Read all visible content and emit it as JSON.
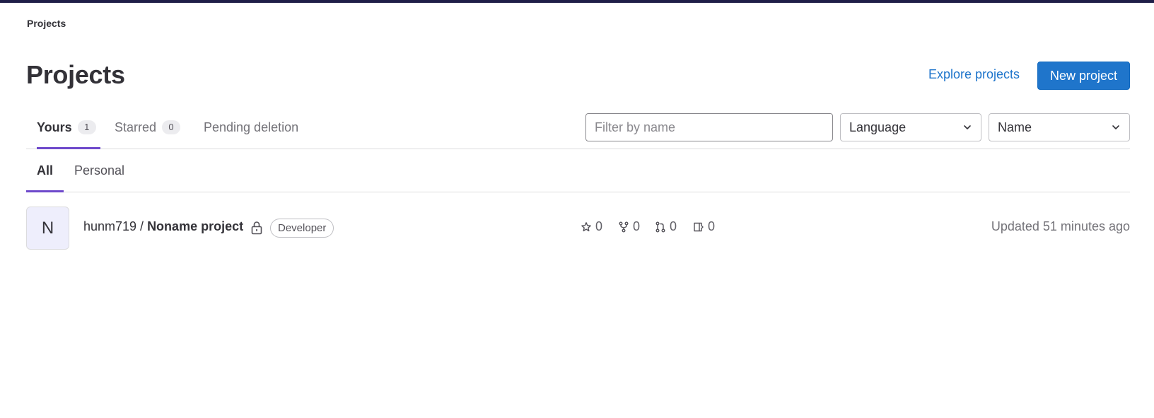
{
  "breadcrumb": {
    "label": "Projects"
  },
  "header": {
    "title": "Projects",
    "explore_label": "Explore projects",
    "new_project_label": "New project",
    "accent_color": "#1f75cb"
  },
  "tabs": [
    {
      "label": "Yours",
      "count": "1",
      "active": true
    },
    {
      "label": "Starred",
      "count": "0",
      "active": false
    },
    {
      "label": "Pending deletion",
      "active": false
    }
  ],
  "filters": {
    "filter_placeholder": "Filter by name",
    "language_value": "Language",
    "sort_value": "Name"
  },
  "subtabs": [
    {
      "label": "All",
      "active": true
    },
    {
      "label": "Personal",
      "active": false
    }
  ],
  "projects": [
    {
      "avatar_letter": "N",
      "namespace": "hunm719 / ",
      "name": "Noname project",
      "visibility_icon": "lock-icon",
      "role": "Developer",
      "stars": "0",
      "forks": "0",
      "merge_requests": "0",
      "issues": "0",
      "updated": "Updated 51 minutes ago"
    }
  ]
}
